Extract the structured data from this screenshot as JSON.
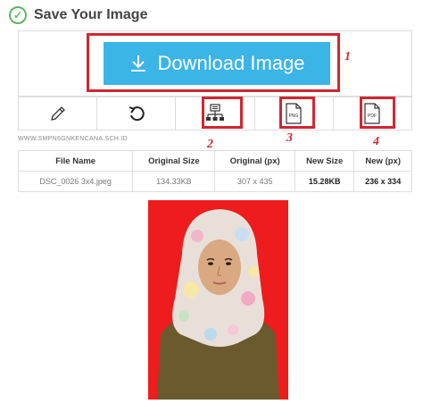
{
  "header": {
    "title": "Save Your Image",
    "icon": "check-circle-icon"
  },
  "download": {
    "label": "Download Image",
    "icon": "download-icon",
    "color": "#3bb4e8"
  },
  "annotations": {
    "n1": "1",
    "n2": "2",
    "n3": "3",
    "n4": "4",
    "color": "#d22630"
  },
  "tools": [
    {
      "icon": "pencil-icon"
    },
    {
      "icon": "undo-icon"
    },
    {
      "icon": "network-icon",
      "label": "2"
    },
    {
      "icon": "png-file-icon",
      "text": "PNG",
      "label": "3"
    },
    {
      "icon": "pdf-file-icon",
      "text": "PDF",
      "label": "4"
    }
  ],
  "watermark": "WWW.SMPN6GNKENCANA.SCH.ID",
  "table": {
    "headers": [
      "File Name",
      "Original Size",
      "Original (px)",
      "New Size",
      "New (px)"
    ],
    "row": [
      "DSC_0026 3x4.jpeg",
      "134.33KB",
      "307 x 435",
      "15.28KB",
      "236 x 334"
    ]
  },
  "photo": {
    "background": "#ee1c1c"
  }
}
